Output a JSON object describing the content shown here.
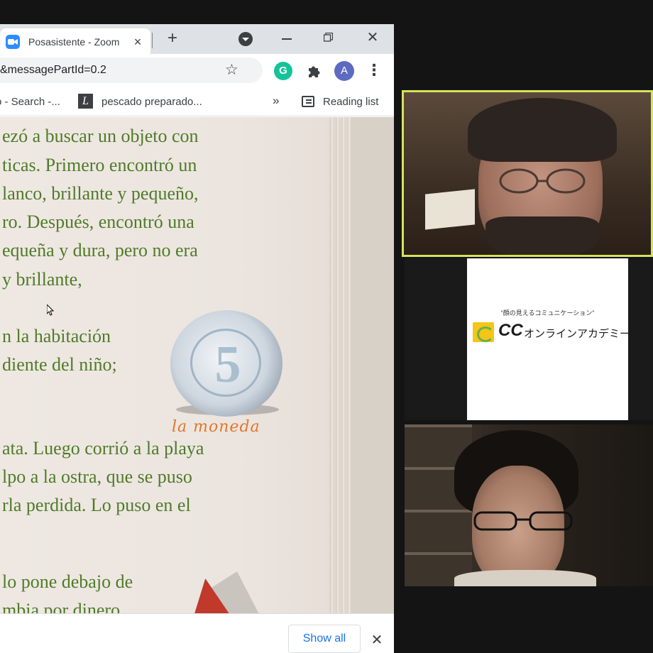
{
  "browser": {
    "tab": {
      "title": "Posasistente - Zoom",
      "close": "×"
    },
    "new_tab": "+",
    "window": {
      "close": "✕"
    },
    "url": "&messagePartId=0.2",
    "profile_initial": "A",
    "grammarly_letter": "G",
    "bookmarks": [
      {
        "label": "o - Search -..."
      },
      {
        "label": "pescado preparado..."
      }
    ],
    "bookmarks_more": "»",
    "reading_list": "Reading list",
    "download_bar": {
      "show_all": "Show all",
      "close": "✕"
    }
  },
  "page": {
    "story_lines": [
      "ezó a buscar un objeto con",
      "ticas. Primero encontró un",
      "lanco, brillante y pequeño,",
      "ro. Después, encontró una",
      "equeña y dura, pero no era",
      " y brillante,",
      "n la habitación",
      "diente del niño;",
      "ata. Luego corrió a la playa",
      "lpo a la ostra, que se puso",
      "rla perdida. Lo puso en el",
      "lo pone debajo de",
      "mbia por dinero"
    ],
    "coin_digit": "5",
    "coin_label": "la moneda"
  },
  "zoom": {
    "logo_tagline": "“顔の見えるコミュニケーション”",
    "logo_cc": "CC",
    "logo_name": "オンラインアカデミー"
  },
  "colors": {
    "active_speaker_border": "#d6e35a",
    "story_text": "#4f7b2a",
    "coin_label": "#e0772e",
    "show_all": "#1a73e8"
  }
}
